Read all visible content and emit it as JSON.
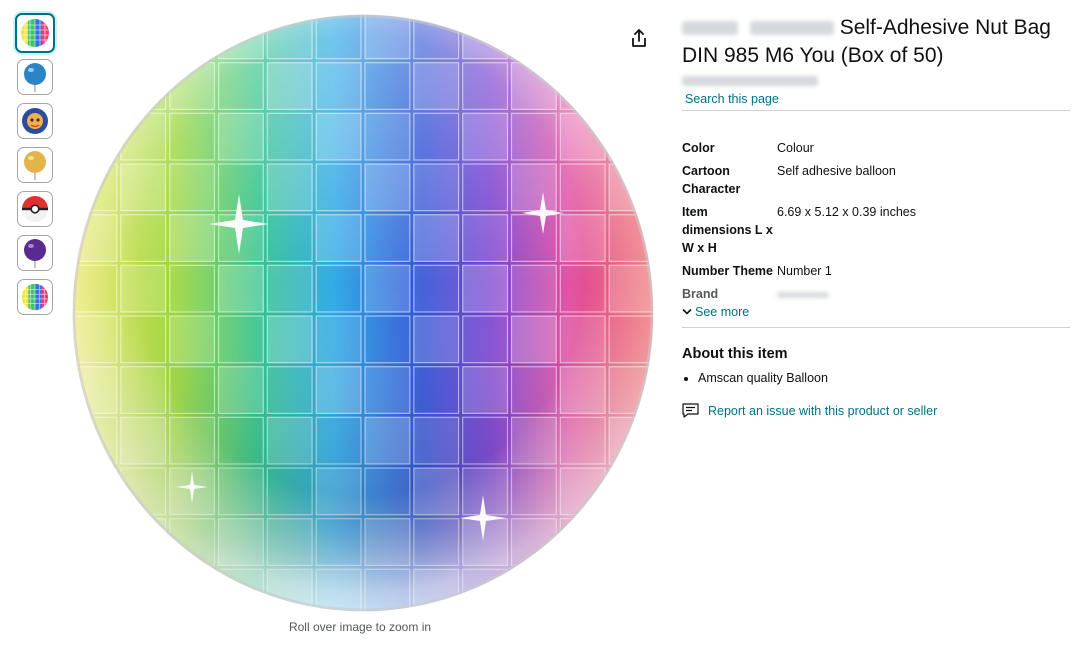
{
  "thumbnails": [
    {
      "kind": "disco",
      "selected": true
    },
    {
      "kind": "blue-balloon",
      "selected": false
    },
    {
      "kind": "character-balloon",
      "selected": false
    },
    {
      "kind": "gold-balloon",
      "selected": false
    },
    {
      "kind": "pokeball-balloon",
      "selected": false
    },
    {
      "kind": "purple-balloon",
      "selected": false
    },
    {
      "kind": "disco",
      "selected": false
    }
  ],
  "zoom_hint": "Roll over image to zoom in",
  "product": {
    "title": "Self-Adhesive Nut Bag DIN 985 M6 You (Box of 50)",
    "search_link": "Search this page"
  },
  "specs": [
    {
      "label": "Color",
      "value": "Colour"
    },
    {
      "label": "Cartoon Character",
      "value": "Self adhesive balloon"
    },
    {
      "label": "Item dimensions L x W x H",
      "value": "6.69 x 5.12 x 0.39 inches"
    },
    {
      "label": "Number Theme",
      "value": "Number 1"
    },
    {
      "label": "Brand",
      "value": ""
    }
  ],
  "see_more": "See more",
  "about": {
    "heading": "About this item",
    "bullets": [
      "Amscan quality Balloon"
    ]
  },
  "report_link": "Report an issue with this product or seller",
  "colors": {
    "link": "#007185",
    "selected_border": "#007185",
    "text": "#0f1111"
  }
}
